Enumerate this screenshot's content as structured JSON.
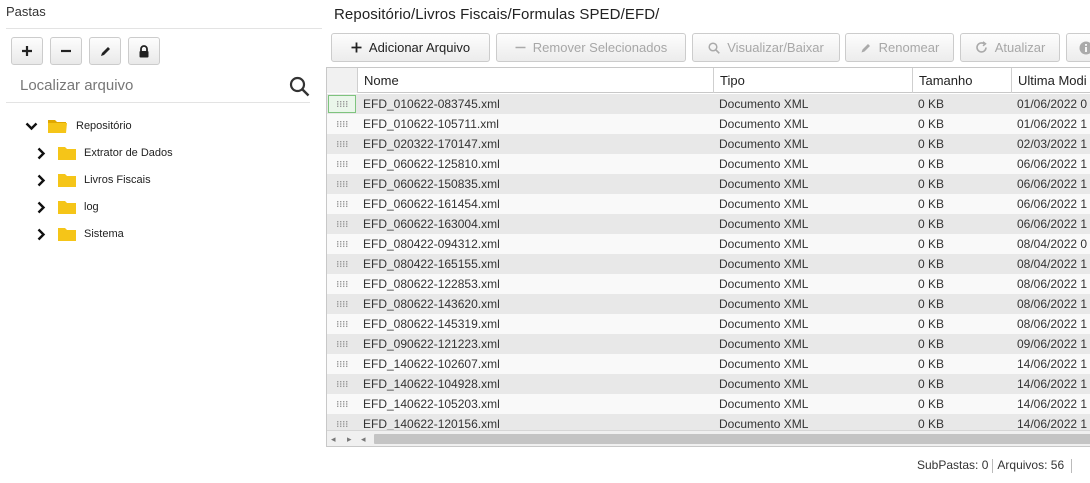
{
  "left_panel": {
    "title": "Pastas",
    "toolbar": {
      "add_icon": "plus-icon",
      "remove_icon": "minus-icon",
      "rename_icon": "pencil-icon",
      "lock_icon": "lock-icon"
    },
    "search": {
      "placeholder": "Localizar arquivo",
      "value": ""
    },
    "tree": {
      "root": {
        "label": "Repositório",
        "expanded": true
      },
      "children": [
        {
          "label": "Extrator de Dados"
        },
        {
          "label": "Livros Fiscais"
        },
        {
          "label": "log"
        },
        {
          "label": "Sistema"
        }
      ]
    }
  },
  "main": {
    "path": "Repositório/Livros Fiscais/Formulas SPED/EFD/",
    "actions": [
      {
        "label": "Adicionar Arquivo",
        "icon": "plus-icon",
        "enabled": true
      },
      {
        "label": "Remover Selecionados",
        "icon": "minus-icon",
        "enabled": false
      },
      {
        "label": "Visualizar/Baixar",
        "icon": "search-icon",
        "enabled": false
      },
      {
        "label": "Renomear",
        "icon": "pencil-icon",
        "enabled": false
      },
      {
        "label": "Atualizar",
        "icon": "refresh-icon",
        "enabled": false
      },
      {
        "label": "",
        "icon": "info-icon",
        "enabled": false
      }
    ],
    "table": {
      "columns": [
        "Nome",
        "Tipo",
        "Tamanho",
        "Ultima Modi"
      ],
      "rows": [
        {
          "name": "EFD_010622-083745.xml",
          "type": "Documento XML",
          "size": "0 KB",
          "modified": "01/06/2022 0"
        },
        {
          "name": "EFD_010622-105711.xml",
          "type": "Documento XML",
          "size": "0 KB",
          "modified": "01/06/2022 1"
        },
        {
          "name": "EFD_020322-170147.xml",
          "type": "Documento XML",
          "size": "0 KB",
          "modified": "02/03/2022 1"
        },
        {
          "name": "EFD_060622-125810.xml",
          "type": "Documento XML",
          "size": "0 KB",
          "modified": "06/06/2022 1"
        },
        {
          "name": "EFD_060622-150835.xml",
          "type": "Documento XML",
          "size": "0 KB",
          "modified": "06/06/2022 1"
        },
        {
          "name": "EFD_060622-161454.xml",
          "type": "Documento XML",
          "size": "0 KB",
          "modified": "06/06/2022 1"
        },
        {
          "name": "EFD_060622-163004.xml",
          "type": "Documento XML",
          "size": "0 KB",
          "modified": "06/06/2022 1"
        },
        {
          "name": "EFD_080422-094312.xml",
          "type": "Documento XML",
          "size": "0 KB",
          "modified": "08/04/2022 0"
        },
        {
          "name": "EFD_080422-165155.xml",
          "type": "Documento XML",
          "size": "0 KB",
          "modified": "08/04/2022 1"
        },
        {
          "name": "EFD_080622-122853.xml",
          "type": "Documento XML",
          "size": "0 KB",
          "modified": "08/06/2022 1"
        },
        {
          "name": "EFD_080622-143620.xml",
          "type": "Documento XML",
          "size": "0 KB",
          "modified": "08/06/2022 1"
        },
        {
          "name": "EFD_080622-145319.xml",
          "type": "Documento XML",
          "size": "0 KB",
          "modified": "08/06/2022 1"
        },
        {
          "name": "EFD_090622-121223.xml",
          "type": "Documento XML",
          "size": "0 KB",
          "modified": "09/06/2022 1"
        },
        {
          "name": "EFD_140622-102607.xml",
          "type": "Documento XML",
          "size": "0 KB",
          "modified": "14/06/2022 1"
        },
        {
          "name": "EFD_140622-104928.xml",
          "type": "Documento XML",
          "size": "0 KB",
          "modified": "14/06/2022 1"
        },
        {
          "name": "EFD_140622-105203.xml",
          "type": "Documento XML",
          "size": "0 KB",
          "modified": "14/06/2022 1"
        },
        {
          "name": "EFD_140622-120156.xml",
          "type": "Documento XML",
          "size": "0 KB",
          "modified": "14/06/2022 1"
        }
      ]
    },
    "status": {
      "subfolders_label": "SubPastas:",
      "subfolders_value": "0",
      "files_label": "Arquivos:",
      "files_value": "56"
    }
  },
  "colors": {
    "folder": "#f5c518",
    "row_even": "#e8e8e8",
    "row_odd": "#f9f9f9",
    "selected_border": "#7ec47e"
  }
}
